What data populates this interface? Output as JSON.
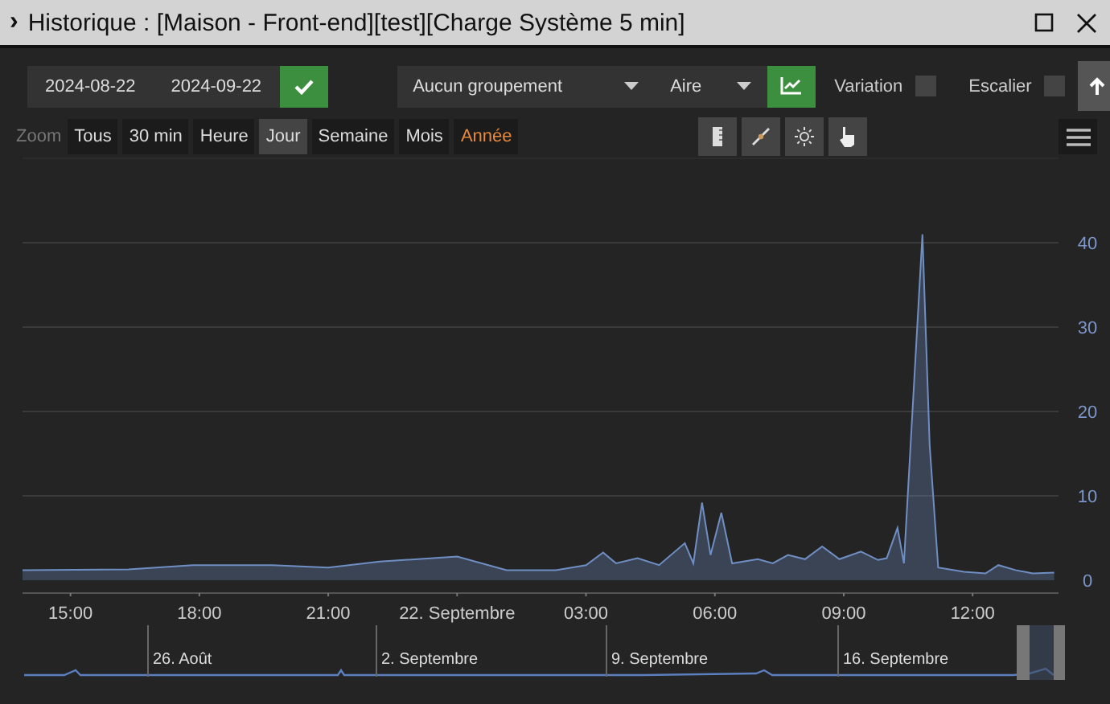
{
  "window": {
    "title": "Historique : [Maison - Front-end][test][Charge Système 5 min]",
    "expand_icon": "›"
  },
  "date_range": {
    "start": "2024-08-22",
    "end": "2024-09-22"
  },
  "grouping": {
    "value": "Aucun groupement"
  },
  "chart_type": {
    "value": "Aire"
  },
  "options": [
    {
      "label": "Variation",
      "checked": false
    },
    {
      "label": "Escalier",
      "checked": false
    }
  ],
  "zoom": {
    "label": "Zoom",
    "buttons": [
      {
        "label": "Tous",
        "selected": false,
        "highlighted": false
      },
      {
        "label": "30 min",
        "selected": false,
        "highlighted": false
      },
      {
        "label": "Heure",
        "selected": false,
        "highlighted": false
      },
      {
        "label": "Jour",
        "selected": true,
        "highlighted": false
      },
      {
        "label": "Semaine",
        "selected": false,
        "highlighted": false
      },
      {
        "label": "Mois",
        "selected": false,
        "highlighted": false
      },
      {
        "label": "Année",
        "selected": false,
        "highlighted": true
      }
    ]
  },
  "chart_data": {
    "type": "area",
    "grid": true,
    "ylim": [
      0,
      50
    ],
    "xlim": [
      "2024-09-21T13:53",
      "2024-09-22T14:00"
    ],
    "xticks": [
      {
        "value": "2024-09-21T15:00",
        "label": "15:00"
      },
      {
        "value": "2024-09-21T18:00",
        "label": "18:00"
      },
      {
        "value": "2024-09-21T21:00",
        "label": "21:00"
      },
      {
        "value": "2024-09-22T00:00",
        "label": "22. Septembre"
      },
      {
        "value": "2024-09-22T03:00",
        "label": "03:00"
      },
      {
        "value": "2024-09-22T06:00",
        "label": "06:00"
      },
      {
        "value": "2024-09-22T09:00",
        "label": "09:00"
      },
      {
        "value": "2024-09-22T12:00",
        "label": "12:00"
      }
    ],
    "yticks": [
      0,
      10,
      20,
      30,
      40
    ],
    "x": [
      "2024-09-21T13:53",
      "2024-09-21T16:21",
      "2024-09-21T17:51",
      "2024-09-21T19:42",
      "2024-09-21T21:00",
      "2024-09-21T22:12",
      "2024-09-22T00:00",
      "2024-09-22T01:09",
      "2024-09-22T02:18",
      "2024-09-22T03:00",
      "2024-09-22T03:24",
      "2024-09-22T03:42",
      "2024-09-22T04:12",
      "2024-09-22T04:42",
      "2024-09-22T05:18",
      "2024-09-22T05:30",
      "2024-09-22T05:42",
      "2024-09-22T05:54",
      "2024-09-22T06:09",
      "2024-09-22T06:24",
      "2024-09-22T07:00",
      "2024-09-22T07:21",
      "2024-09-22T07:42",
      "2024-09-22T08:06",
      "2024-09-22T08:30",
      "2024-09-22T08:54",
      "2024-09-22T09:24",
      "2024-09-22T09:48",
      "2024-09-22T10:00",
      "2024-09-22T10:15",
      "2024-09-22T10:24",
      "2024-09-22T10:50",
      "2024-09-22T11:00",
      "2024-09-22T11:12",
      "2024-09-22T11:48",
      "2024-09-22T12:18",
      "2024-09-22T12:36",
      "2024-09-22T13:00",
      "2024-09-22T13:24",
      "2024-09-22T13:54"
    ],
    "series": [
      {
        "color": "#6f8fc4",
        "values": [
          1.2,
          1.3,
          1.8,
          1.8,
          1.5,
          2.2,
          2.8,
          1.2,
          1.2,
          1.8,
          3.3,
          2.0,
          2.6,
          1.8,
          4.4,
          2,
          9.2,
          3,
          8,
          2,
          2.5,
          2,
          3,
          2.5,
          4,
          2.5,
          3.4,
          2.4,
          2.6,
          6.2,
          2,
          41,
          16,
          1.5,
          1,
          0.8,
          1.8,
          1.2,
          0.8,
          0.9
        ]
      }
    ]
  },
  "navigator": {
    "labels": [
      "26. Août",
      "2. Septembre",
      "9. Septembre",
      "16. Septembre"
    ]
  }
}
